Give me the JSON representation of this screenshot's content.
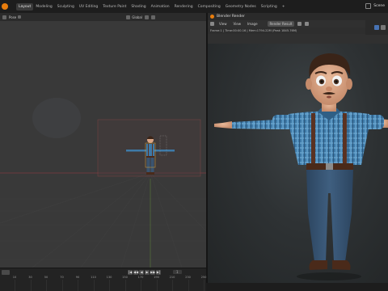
{
  "app": {
    "workspace_tabs": [
      "Layout",
      "Modeling",
      "Sculpting",
      "UV Editing",
      "Texture Paint",
      "Shading",
      "Animation",
      "Rendering",
      "Compositing",
      "Geometry Nodes",
      "Scripting"
    ],
    "active_tab": "Layout",
    "add_tab": "+",
    "scene_name": "Scene"
  },
  "viewport": {
    "mode_label": "Pose",
    "transform_label": "Global"
  },
  "render_window": {
    "title": "Blender Render",
    "menu": [
      "View",
      "View",
      "Image"
    ],
    "slot_label": "Render Result",
    "stats": "Frame:1 | Time:00:00.16 | Mem:1794.22M (Peak 1845.76M)"
  },
  "timeline": {
    "current_frame": "1",
    "ticks": [
      "10",
      "30",
      "50",
      "70",
      "90",
      "110",
      "130",
      "150",
      "170",
      "190",
      "210",
      "230",
      "250"
    ],
    "play_buttons": [
      "|◀",
      "◀◀",
      "◀",
      "▶",
      "▶▶",
      "▶|"
    ]
  },
  "colors": {
    "accent": "#e87d0d",
    "selection_box": "#b44a4a",
    "shirt": "#3e7aa8",
    "suspenders": "#5a3222",
    "jeans": "#3a5470",
    "skin": "#d9a485",
    "hair": "#3a2418"
  }
}
